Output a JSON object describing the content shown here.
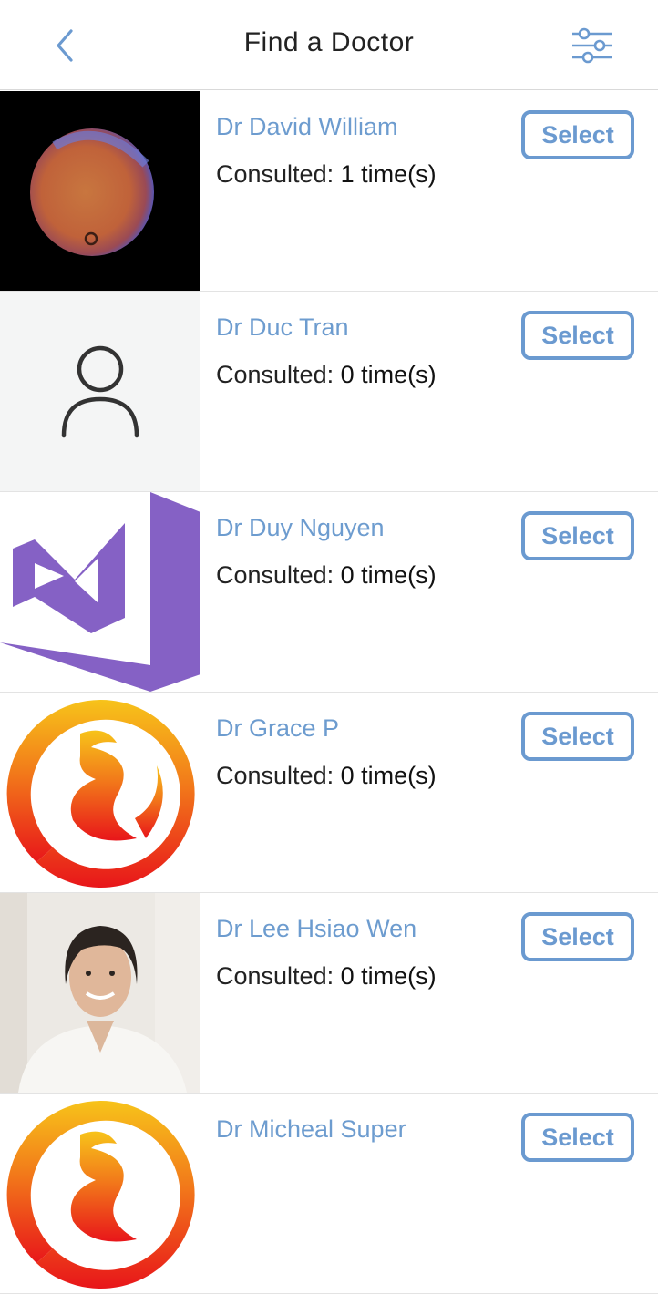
{
  "header": {
    "title": "Find a Doctor",
    "back_icon": "chevron-left-icon",
    "filter_icon": "sliders-icon"
  },
  "colors": {
    "accent": "#6b9ad0",
    "name_text": "#6d9ccf",
    "divider": "#e3e3e3"
  },
  "doctors": [
    {
      "name": "Dr David William",
      "consulted_label": "Consulted:",
      "consulted_value": "1 time(s)",
      "select_label": "Select",
      "avatar": "planet-photo"
    },
    {
      "name": "Dr Duc Tran",
      "consulted_label": "Consulted:",
      "consulted_value": "0 time(s)",
      "select_label": "Select",
      "avatar": "default-user-icon"
    },
    {
      "name": "Dr Duy Nguyen",
      "consulted_label": "Consulted:",
      "consulted_value": "0 time(s)",
      "select_label": "Select",
      "avatar": "visual-studio-logo"
    },
    {
      "name": "Dr Grace P",
      "consulted_label": "Consulted:",
      "consulted_value": "0 time(s)",
      "select_label": "Select",
      "avatar": "firebird-logo"
    },
    {
      "name": "Dr Lee Hsiao Wen",
      "consulted_label": "Consulted:",
      "consulted_value": "0 time(s)",
      "select_label": "Select",
      "avatar": "woman-portrait-photo"
    },
    {
      "name": "Dr Micheal Super",
      "consulted_label": "",
      "consulted_value": "",
      "select_label": "Select",
      "avatar": "firebird-logo"
    }
  ]
}
